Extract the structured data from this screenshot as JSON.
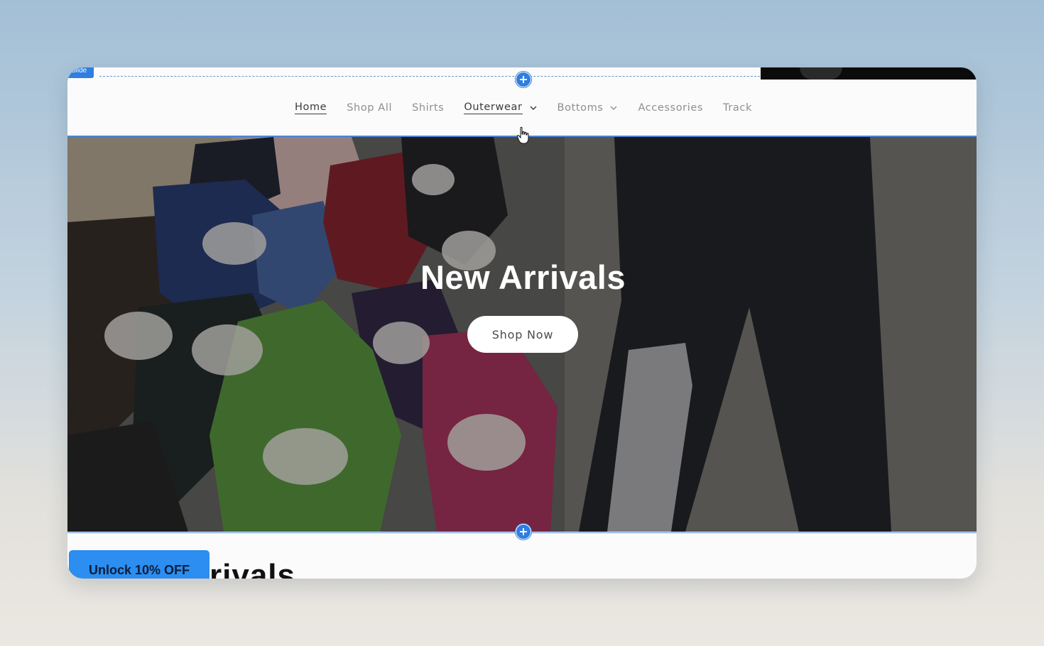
{
  "editor": {
    "badge_label": "Slide"
  },
  "nav": {
    "items": [
      {
        "label": "Home",
        "state": "active",
        "has_dropdown": false
      },
      {
        "label": "Shop All",
        "state": "default",
        "has_dropdown": false
      },
      {
        "label": "Shirts",
        "state": "default",
        "has_dropdown": false
      },
      {
        "label": "Outerwear",
        "state": "hover",
        "has_dropdown": true
      },
      {
        "label": "Bottoms",
        "state": "default",
        "has_dropdown": true
      },
      {
        "label": "Accessories",
        "state": "default",
        "has_dropdown": false
      },
      {
        "label": "Track",
        "state": "default",
        "has_dropdown": false
      }
    ]
  },
  "hero": {
    "title": "New Arrivals",
    "cta_label": "Shop Now"
  },
  "promo": {
    "label": "Unlock 10% OFF"
  },
  "section": {
    "heading_partial": "rivals"
  },
  "colors": {
    "editor_accent": "#2f7ee0",
    "promo_button": "#2b8ef0",
    "nav_text": "#8f8f8f",
    "nav_active": "#3b3b3b"
  },
  "icons": {
    "add_section_top": "plus-circle-icon",
    "add_section_bottom": "plus-circle-icon",
    "dropdown": "chevron-down-icon",
    "cursor": "hand-pointer-icon"
  }
}
